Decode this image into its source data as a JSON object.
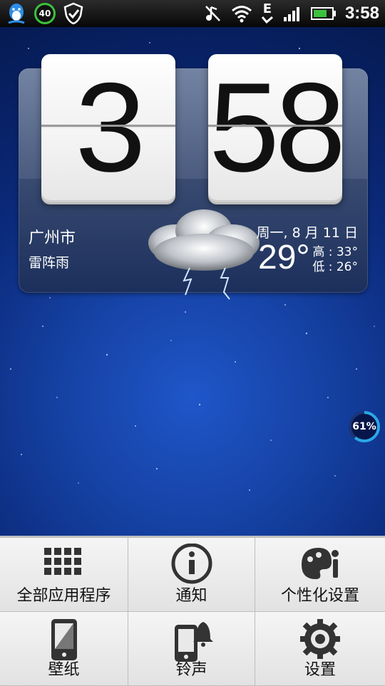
{
  "status_bar": {
    "time": "3:58",
    "badge_number": "40",
    "network_type": "E",
    "icons": [
      "qq-icon",
      "40-badge-icon",
      "security-shield-icon",
      "silent-icon",
      "wifi-icon",
      "edge-network-icon",
      "signal-icon",
      "battery-icon"
    ]
  },
  "clock_widget": {
    "hour": "3",
    "minute": "58",
    "city": "广州市",
    "condition": "雷阵雨",
    "date": "周一, 8 月 11 日",
    "temperature": "29°",
    "high": "高 : 33°",
    "low": "低 : 26°",
    "weather_icon": "thunderstorm-cloud-icon"
  },
  "battery_widget": {
    "level_text": "61%",
    "level": 0.61
  },
  "menu": {
    "items": [
      {
        "label": "全部应用程序",
        "icon": "all-apps-grid-icon"
      },
      {
        "label": "通知",
        "icon": "info-icon"
      },
      {
        "label": "个性化设置",
        "icon": "palette-brush-icon"
      },
      {
        "label": "壁纸",
        "icon": "wallpaper-phone-icon"
      },
      {
        "label": "铃声",
        "icon": "ringtone-phone-bell-icon"
      },
      {
        "label": "设置",
        "icon": "settings-gear-icon"
      }
    ]
  },
  "colors": {
    "accent_green": "#3cc13c",
    "wallpaper_blue": "#143f9f",
    "battery_ring": "#2aa7e8"
  }
}
